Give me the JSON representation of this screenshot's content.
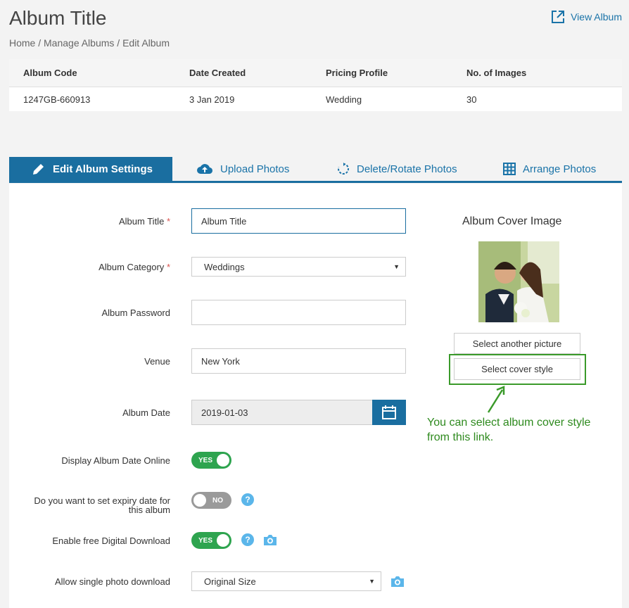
{
  "header": {
    "title": "Album Title",
    "view_album": "View Album",
    "breadcrumb": "Home / Manage Albums / Edit Album"
  },
  "info": {
    "headers": [
      "Album Code",
      "Date Created",
      "Pricing Profile",
      "No. of Images"
    ],
    "values": [
      "1247GB-660913",
      "3 Jan 2019",
      "Wedding",
      "30"
    ]
  },
  "tabs": [
    {
      "label": "Edit Album Settings",
      "icon": "pencil-icon",
      "active": true
    },
    {
      "label": "Upload Photos",
      "icon": "cloud-upload-icon"
    },
    {
      "label": "Delete/Rotate Photos",
      "icon": "rotate-icon"
    },
    {
      "label": "Arrange Photos",
      "icon": "grid-icon"
    }
  ],
  "form": {
    "album_title_label": "Album Title",
    "album_title_value": "Album Title",
    "album_category_label": "Album Category",
    "album_category_value": "Weddings",
    "album_password_label": "Album Password",
    "album_password_value": "",
    "venue_label": "Venue",
    "venue_value": "New York",
    "album_date_label": "Album Date",
    "album_date_value": "2019-01-03",
    "display_date_label": "Display Album Date Online",
    "display_date_toggle": "YES",
    "expiry_label_1": "Do you want to set expiry date for",
    "expiry_label_2": "this album",
    "expiry_toggle": "NO",
    "digital_download_label": "Enable free Digital Download",
    "digital_download_toggle": "YES",
    "single_download_label": "Allow single photo download",
    "single_download_value": "Original Size",
    "required_mark": "*",
    "help_glyph": "?"
  },
  "cover": {
    "title": "Album Cover Image",
    "select_picture": "Select another picture",
    "select_style": "Select cover style",
    "callout_1": "You can select album cover style",
    "callout_2": "from this link."
  },
  "colors": {
    "accent": "#1a6ea0",
    "toggle_on": "#2ea44f",
    "toggle_off": "#9a9a9a",
    "help": "#5bb6ea",
    "callout": "#2e8a1e"
  }
}
